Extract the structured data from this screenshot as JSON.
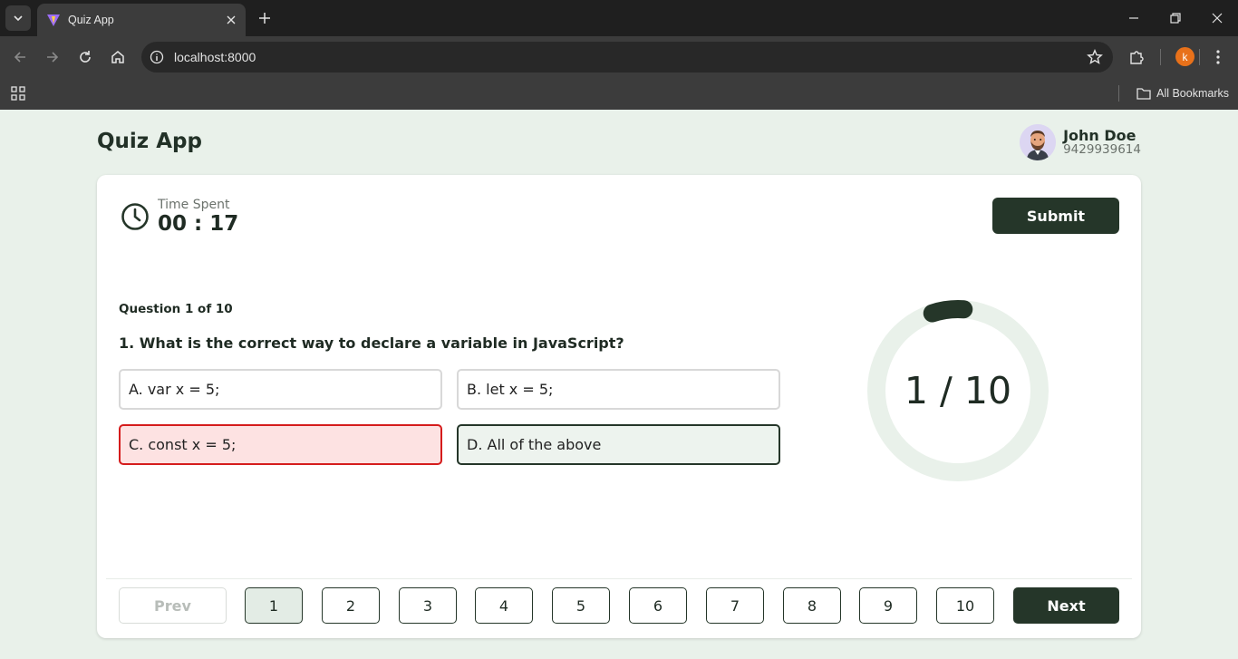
{
  "browser": {
    "tab_title": "Quiz App",
    "url": "localhost:8000",
    "profile_initial": "k",
    "bookmarks_label": "All Bookmarks"
  },
  "header": {
    "title": "Quiz App",
    "user_name": "John Doe",
    "user_phone": "9429939614"
  },
  "timer": {
    "label": "Time Spent",
    "value": "00 : 17"
  },
  "submit_label": "Submit",
  "question": {
    "counter": "Question 1 of 10",
    "text": "1. What is the correct way to declare a variable in JavaScript?",
    "options": [
      {
        "label": "A. var x = 5;",
        "state": "default"
      },
      {
        "label": "B. let x = 5;",
        "state": "default"
      },
      {
        "label": "C. const x = 5;",
        "state": "wrong"
      },
      {
        "label": "D. All of the above",
        "state": "selected"
      }
    ]
  },
  "progress": {
    "text": "1 / 10",
    "current": 1,
    "total": 10
  },
  "pagination": {
    "prev_label": "Prev",
    "next_label": "Next",
    "pages": [
      "1",
      "2",
      "3",
      "4",
      "5",
      "6",
      "7",
      "8",
      "9",
      "10"
    ],
    "active_page": "1"
  },
  "colors": {
    "accent": "#253629",
    "wrong_border": "#d51c1c",
    "wrong_bg": "#fde2e2",
    "page_bg": "#e9f1ea"
  }
}
